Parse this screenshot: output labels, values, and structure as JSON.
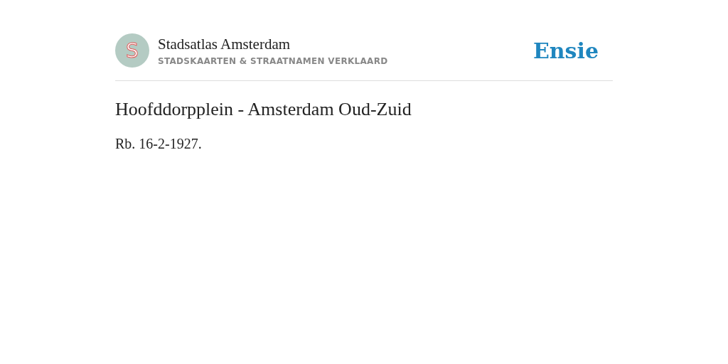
{
  "header": {
    "logo_letter": "S",
    "site_title": "Stadsatlas Amsterdam",
    "tagline": "STADSKAARTEN & STRAATNAMEN VERKLAARD",
    "brand": "Ensie"
  },
  "article": {
    "title": "Hoofddorpplein - Amsterdam Oud-Zuid",
    "body": "Rb. 16-2-1927."
  }
}
